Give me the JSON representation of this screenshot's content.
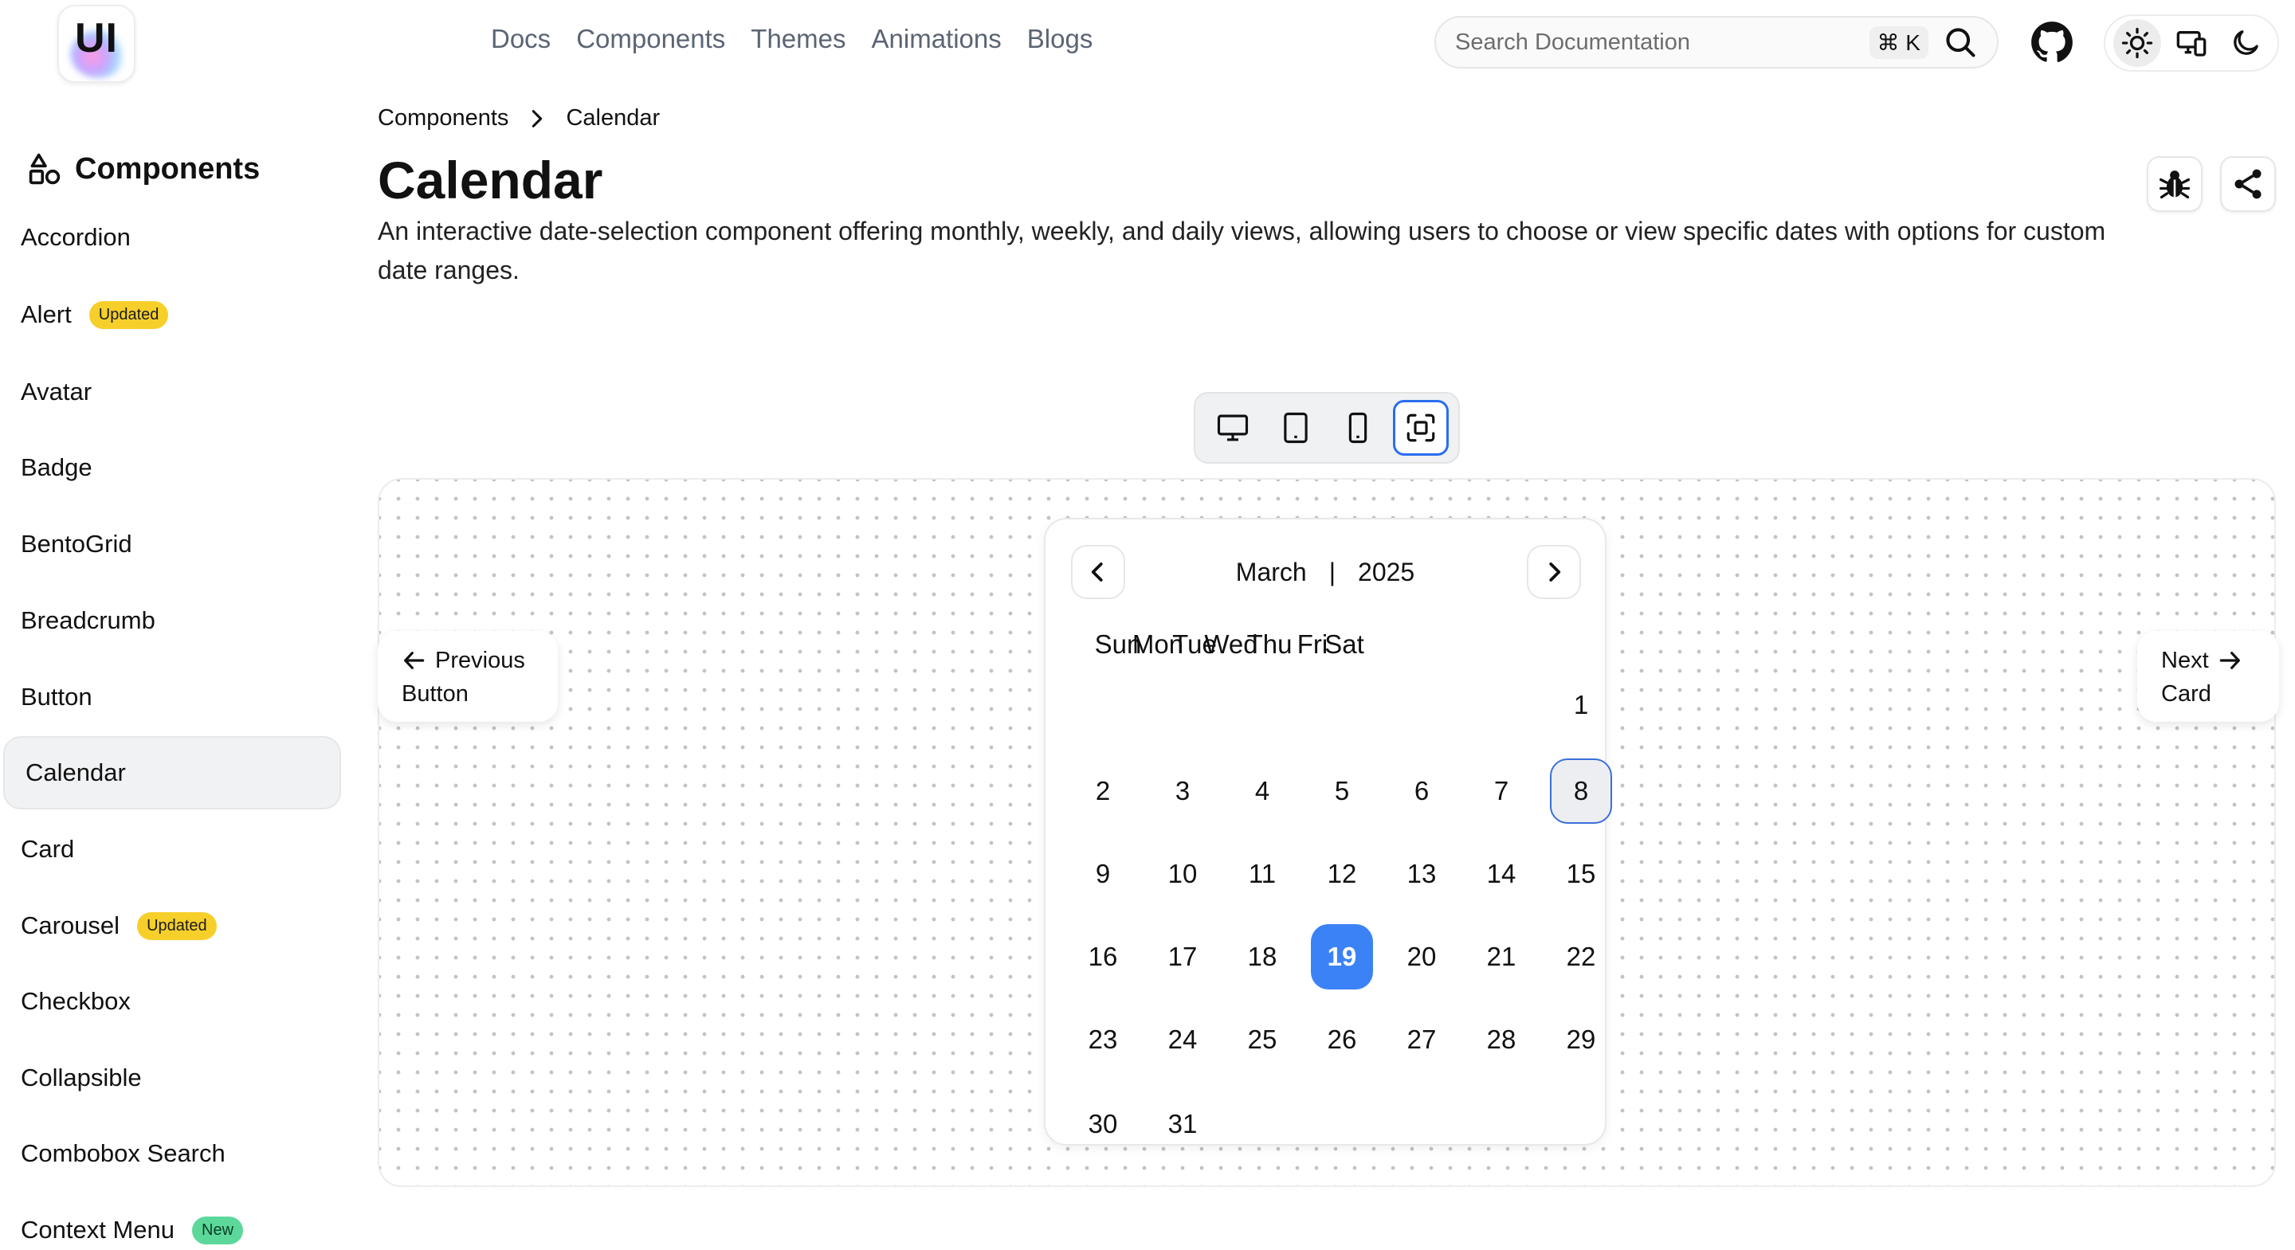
{
  "header": {
    "logo_text": "UI",
    "nav": [
      "Docs",
      "Components",
      "Themes",
      "Animations",
      "Blogs"
    ],
    "search_placeholder": "Search Documentation",
    "search_shortcut": "⌘ K"
  },
  "sidebar": {
    "heading": "Components",
    "items": [
      {
        "label": "Accordion"
      },
      {
        "label": "Alert",
        "badge": "Updated",
        "badge_type": "updated"
      },
      {
        "label": "Avatar"
      },
      {
        "label": "Badge"
      },
      {
        "label": "BentoGrid"
      },
      {
        "label": "Breadcrumb"
      },
      {
        "label": "Button"
      },
      {
        "label": "Calendar",
        "active": true
      },
      {
        "label": "Card"
      },
      {
        "label": "Carousel",
        "badge": "Updated",
        "badge_type": "updated"
      },
      {
        "label": "Checkbox"
      },
      {
        "label": "Collapsible"
      },
      {
        "label": "Combobox Search"
      },
      {
        "label": "Context Menu",
        "badge": "New",
        "badge_type": "new"
      }
    ]
  },
  "breadcrumb": [
    "Components",
    "Calendar"
  ],
  "page": {
    "title": "Calendar",
    "description": "An interactive date-selection component offering monthly, weekly, and daily views, allowing users to choose or view specific dates with options for custom date ranges."
  },
  "pager": {
    "previous_label": "Previous",
    "previous_title": "Button",
    "next_label": "Next",
    "next_title": "Card"
  },
  "calendar": {
    "month": "March",
    "separator": "|",
    "year": "2025",
    "weekdays": [
      "Sun",
      "Mon",
      "Tue",
      "Wed",
      "Thu",
      "Fri",
      "Sat"
    ],
    "first_weekday_index": 6,
    "days_in_month": 31,
    "selected_day": 19,
    "highlighted_day": 8
  },
  "colors": {
    "accent": "#3b82f6",
    "badge_updated": "#f6cf2a",
    "badge_new": "#5cd89a"
  }
}
